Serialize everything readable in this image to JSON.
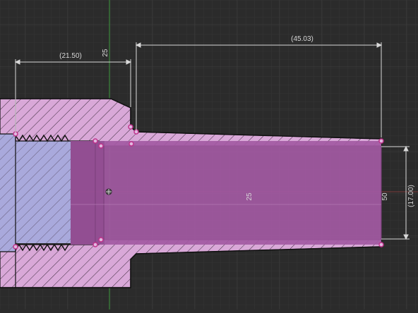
{
  "viewport": {
    "type": "cad-sketch-canvas",
    "colors": {
      "background": "#2b2b2b",
      "grid_minor": "#343434",
      "grid_major": "#3d3d3d",
      "axis_x": "#b24545",
      "axis_y": "#3d9a3d",
      "dimension": "#d8d8d8",
      "profile_outline": "#111111",
      "section_fill": "#d9a8d8",
      "hatch": "#3a2a3a",
      "bore_fill": "#a35aa3",
      "solid_fill": "#a9a9dc",
      "point": "#c0308a"
    }
  },
  "dimensions": {
    "length_overall": "(45.03)",
    "length_thread": "(21.50)",
    "vertical_25": "25",
    "bore_label": "25",
    "right_50": "50",
    "right_diameter": "(17.00)"
  },
  "icons": {
    "origin": "origin-icon",
    "sketch_points": "sketch-point-icon"
  }
}
